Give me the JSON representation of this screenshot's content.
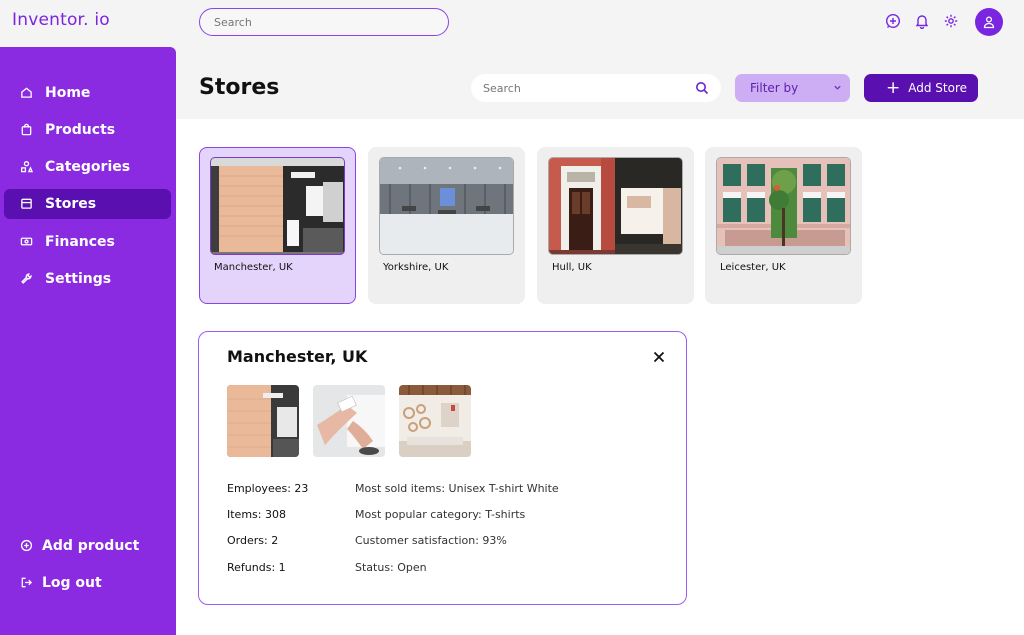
{
  "app": {
    "logo": "Inventor. io"
  },
  "topbar": {
    "search_placeholder": "Search"
  },
  "sidebar": {
    "items": [
      {
        "label": "Home",
        "icon": "home-icon"
      },
      {
        "label": "Products",
        "icon": "shopping-bag-icon"
      },
      {
        "label": "Categories",
        "icon": "shapes-icon"
      },
      {
        "label": "Stores",
        "icon": "store-icon",
        "active": true
      },
      {
        "label": "Finances",
        "icon": "banknote-icon"
      },
      {
        "label": "Settings",
        "icon": "wrench-icon"
      }
    ],
    "bottom": [
      {
        "label": "Add product",
        "icon": "plus-circle-icon"
      },
      {
        "label": "Log out",
        "icon": "logout-icon"
      }
    ]
  },
  "main": {
    "title": "Stores",
    "search_placeholder": "Search",
    "filter_label": "Filter by",
    "add_label": "Add Store"
  },
  "stores": [
    {
      "name": "Manchester, UK",
      "selected": true
    },
    {
      "name": "Yorkshire, UK"
    },
    {
      "name": "Hull, UK"
    },
    {
      "name": "Leicester, UK"
    }
  ],
  "detail": {
    "title": "Manchester, UK",
    "stats_left": [
      "Employees: 23",
      "Items: 308",
      "Orders: 2",
      "Refunds: 1"
    ],
    "stats_right": [
      "Most sold items: Unisex T-shirt White",
      "Most popular category: T-shirts",
      "Customer satisfaction: 93%",
      "Status: Open"
    ]
  },
  "colors": {
    "accent": "#8a2be2",
    "accent_dark": "#5a0fb0",
    "accent_light": "#cdaef5"
  }
}
